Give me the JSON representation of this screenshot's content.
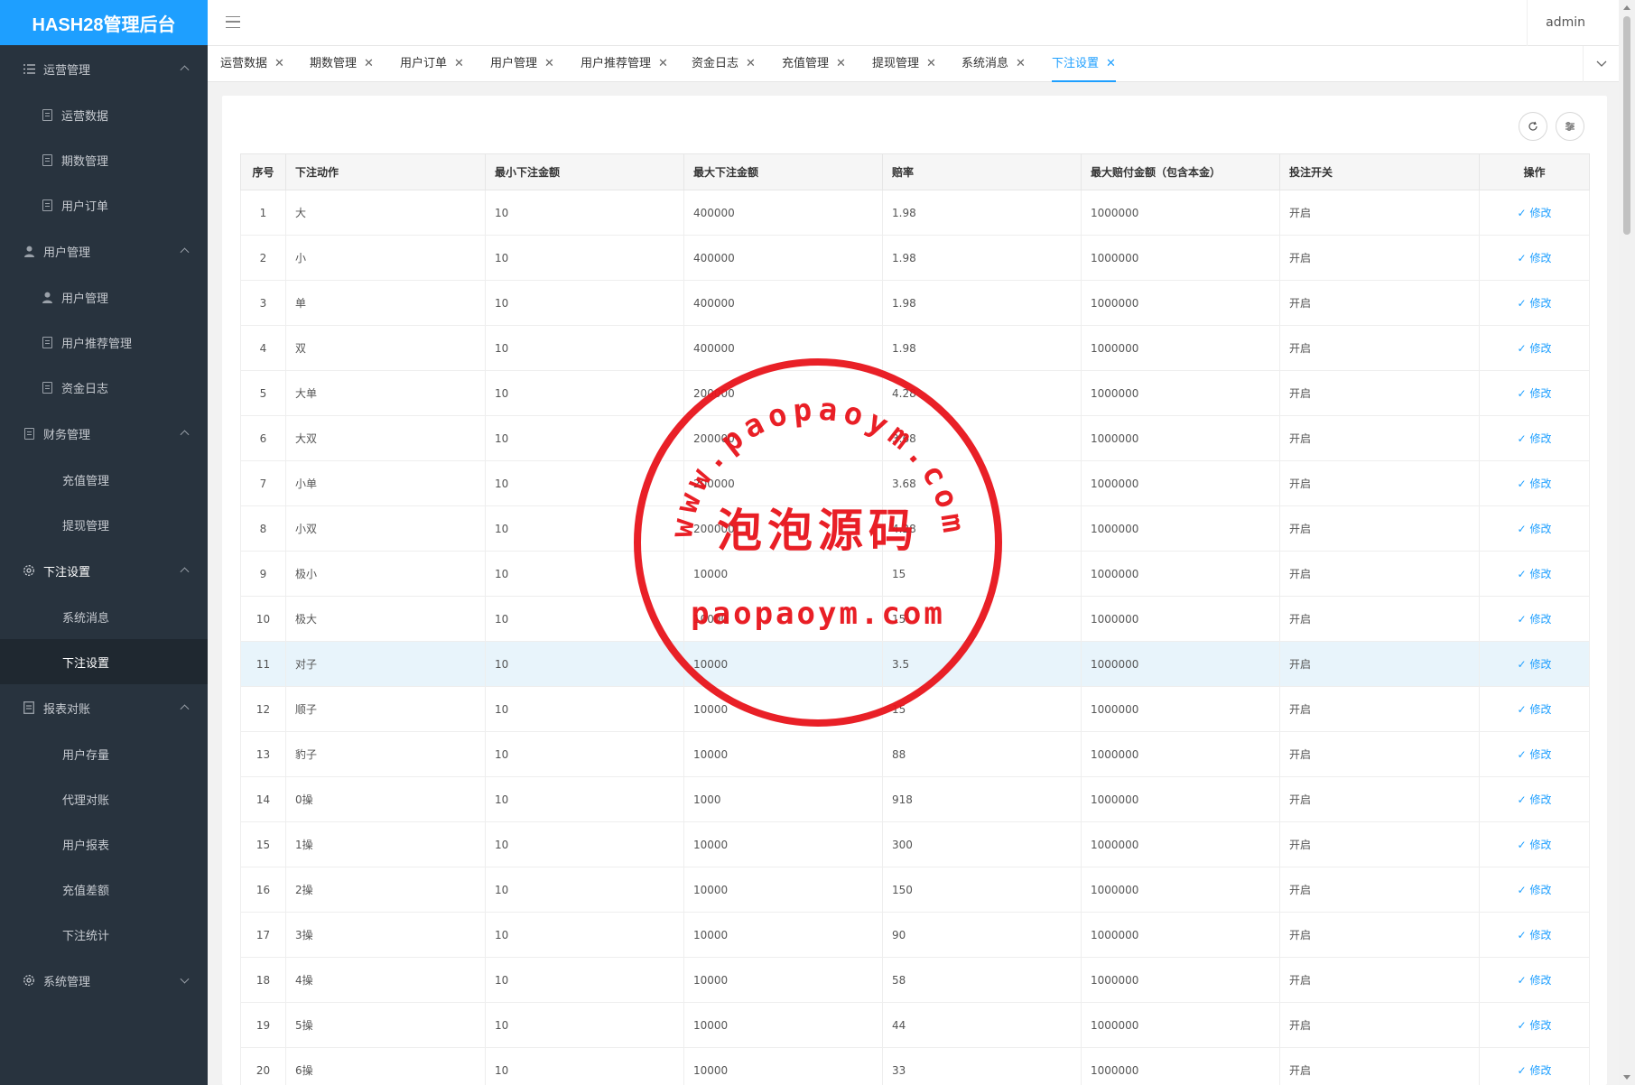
{
  "app": {
    "title": "HASH28管理后台",
    "user": "admin"
  },
  "sidebar": {
    "groups": [
      {
        "label": "运营管理",
        "icon": "list-icon",
        "expanded": true,
        "active": false,
        "items": [
          {
            "label": "运营数据",
            "icon": "doc-icon",
            "active": false
          },
          {
            "label": "期数管理",
            "icon": "doc-icon",
            "active": false
          },
          {
            "label": "用户订单",
            "icon": "doc-icon",
            "active": false
          }
        ]
      },
      {
        "label": "用户管理",
        "icon": "user-icon",
        "expanded": true,
        "active": false,
        "items": [
          {
            "label": "用户管理",
            "icon": "user-icon",
            "active": false
          },
          {
            "label": "用户推荐管理",
            "icon": "doc-icon",
            "active": false
          },
          {
            "label": "资金日志",
            "icon": "doc-icon",
            "active": false
          }
        ]
      },
      {
        "label": "财务管理",
        "icon": "doc-icon",
        "expanded": true,
        "active": false,
        "items": [
          {
            "label": "充值管理",
            "icon": "",
            "active": false
          },
          {
            "label": "提现管理",
            "icon": "",
            "active": false
          }
        ]
      },
      {
        "label": "下注设置",
        "icon": "gear-icon",
        "expanded": true,
        "active": true,
        "items": [
          {
            "label": "系统消息",
            "icon": "",
            "active": false
          },
          {
            "label": "下注设置",
            "icon": "",
            "active": true
          }
        ]
      },
      {
        "label": "报表对账",
        "icon": "report-icon",
        "expanded": true,
        "active": false,
        "items": [
          {
            "label": "用户存量",
            "icon": "",
            "active": false
          },
          {
            "label": "代理对账",
            "icon": "",
            "active": false
          },
          {
            "label": "用户报表",
            "icon": "",
            "active": false
          },
          {
            "label": "充值差额",
            "icon": "",
            "active": false
          },
          {
            "label": "下注统计",
            "icon": "",
            "active": false
          }
        ]
      },
      {
        "label": "系统管理",
        "icon": "gear-icon",
        "expanded": false,
        "active": false,
        "items": []
      }
    ]
  },
  "tabs": [
    {
      "label": "运营数据",
      "active": false
    },
    {
      "label": "期数管理",
      "active": false
    },
    {
      "label": "用户订单",
      "active": false
    },
    {
      "label": "用户管理",
      "active": false
    },
    {
      "label": "用户推荐管理",
      "active": false
    },
    {
      "label": "资金日志",
      "active": false
    },
    {
      "label": "充值管理",
      "active": false
    },
    {
      "label": "提现管理",
      "active": false
    },
    {
      "label": "系统消息",
      "active": false
    },
    {
      "label": "下注设置",
      "active": true
    }
  ],
  "toolbar": {
    "refresh_icon": "refresh-icon",
    "filter_icon": "sliders-icon"
  },
  "table": {
    "columns": [
      "序号",
      "下注动作",
      "最小下注金额",
      "最大下注金额",
      "赔率",
      "最大赔付金额（包含本金）",
      "投注开关",
      "操作"
    ],
    "edit_label": "修改",
    "rows": [
      {
        "idx": "1",
        "action": "大",
        "min": "10",
        "max": "400000",
        "odds": "1.98",
        "payout": "1000000",
        "switch": "开启",
        "blue": true
      },
      {
        "idx": "2",
        "action": "小",
        "min": "10",
        "max": "400000",
        "odds": "1.98",
        "payout": "1000000",
        "switch": "开启",
        "blue": true
      },
      {
        "idx": "3",
        "action": "单",
        "min": "10",
        "max": "400000",
        "odds": "1.98",
        "payout": "1000000",
        "switch": "开启",
        "blue": true
      },
      {
        "idx": "4",
        "action": "双",
        "min": "10",
        "max": "400000",
        "odds": "1.98",
        "payout": "1000000",
        "switch": "开启",
        "blue": true
      },
      {
        "idx": "5",
        "action": "大单",
        "min": "10",
        "max": "200000",
        "odds": "4.28",
        "payout": "1000000",
        "switch": "开启",
        "blue": false
      },
      {
        "idx": "6",
        "action": "大双",
        "min": "10",
        "max": "200000",
        "odds": "3.68",
        "payout": "1000000",
        "switch": "开启",
        "blue": false
      },
      {
        "idx": "7",
        "action": "小单",
        "min": "10",
        "max": "200000",
        "odds": "3.68",
        "payout": "1000000",
        "switch": "开启",
        "blue": false
      },
      {
        "idx": "8",
        "action": "小双",
        "min": "10",
        "max": "200000",
        "odds": "4.28",
        "payout": "1000000",
        "switch": "开启",
        "blue": false
      },
      {
        "idx": "9",
        "action": "极小",
        "min": "10",
        "max": "10000",
        "odds": "15",
        "payout": "1000000",
        "switch": "开启",
        "blue": false
      },
      {
        "idx": "10",
        "action": "极大",
        "min": "10",
        "max": "10000",
        "odds": "15",
        "payout": "1000000",
        "switch": "开启",
        "blue": false
      },
      {
        "idx": "11",
        "action": "对子",
        "min": "10",
        "max": "10000",
        "odds": "3.5",
        "payout": "1000000",
        "switch": "开启",
        "blue": false,
        "highlight": true
      },
      {
        "idx": "12",
        "action": "顺子",
        "min": "10",
        "max": "10000",
        "odds": "15",
        "payout": "1000000",
        "switch": "开启",
        "blue": false
      },
      {
        "idx": "13",
        "action": "豹子",
        "min": "10",
        "max": "10000",
        "odds": "88",
        "payout": "1000000",
        "switch": "开启",
        "blue": false
      },
      {
        "idx": "14",
        "action": "0操",
        "min": "10",
        "max": "1000",
        "odds": "918",
        "payout": "1000000",
        "switch": "开启",
        "blue": false
      },
      {
        "idx": "15",
        "action": "1操",
        "min": "10",
        "max": "10000",
        "odds": "300",
        "payout": "1000000",
        "switch": "开启",
        "blue": false
      },
      {
        "idx": "16",
        "action": "2操",
        "min": "10",
        "max": "10000",
        "odds": "150",
        "payout": "1000000",
        "switch": "开启",
        "blue": false
      },
      {
        "idx": "17",
        "action": "3操",
        "min": "10",
        "max": "10000",
        "odds": "90",
        "payout": "1000000",
        "switch": "开启",
        "blue": false
      },
      {
        "idx": "18",
        "action": "4操",
        "min": "10",
        "max": "10000",
        "odds": "58",
        "payout": "1000000",
        "switch": "开启",
        "blue": false
      },
      {
        "idx": "19",
        "action": "5操",
        "min": "10",
        "max": "10000",
        "odds": "44",
        "payout": "1000000",
        "switch": "开启",
        "blue": false
      },
      {
        "idx": "20",
        "action": "6操",
        "min": "10",
        "max": "10000",
        "odds": "33",
        "payout": "1000000",
        "switch": "开启",
        "blue": false
      }
    ]
  },
  "watermark": {
    "top_arc": "www.paopaoym.com",
    "center": "泡泡源码",
    "bottom": "paopaoym.com",
    "color": "#e8141b"
  }
}
